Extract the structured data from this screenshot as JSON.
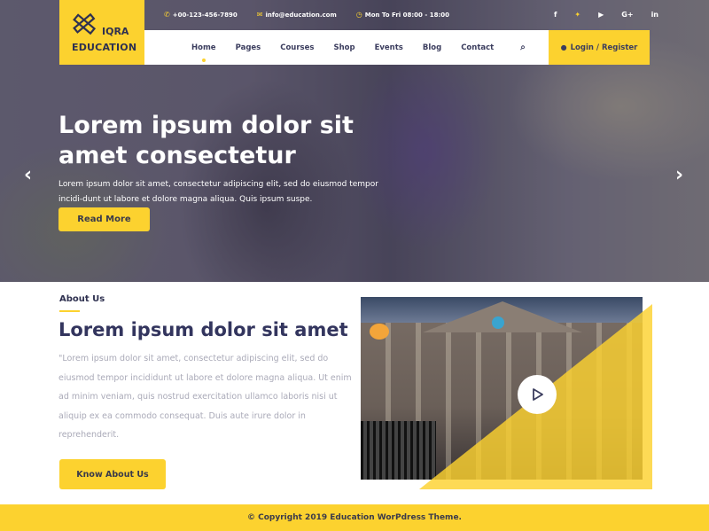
{
  "brand": {
    "line1": "IQRA",
    "line2": "EDUCATION"
  },
  "topbar": {
    "phone": "+00-123-456-7890",
    "email": "info@education.com",
    "hours": "Mon To Fri 08:00 - 18:00",
    "icons": {
      "phone": "✆",
      "email": "✉",
      "hours": "◷"
    }
  },
  "social": [
    {
      "name": "facebook",
      "glyph": "f"
    },
    {
      "name": "twitter",
      "glyph": "🐦"
    },
    {
      "name": "youtube",
      "glyph": "▶"
    },
    {
      "name": "google-plus",
      "glyph": "G+"
    },
    {
      "name": "linkedin",
      "glyph": "in"
    }
  ],
  "nav": {
    "items": [
      "Home",
      "Pages",
      "Courses",
      "Shop",
      "Events",
      "Blog",
      "Contact"
    ],
    "active": "Home",
    "search_icon": "⌕",
    "login_label": "Login / Register",
    "user_icon": "👤"
  },
  "hero": {
    "title_line1": "Lorem ipsum dolor sit",
    "title_line2": "amet consectetur",
    "text": "Lorem ipsum dolor sit amet, consectetur adipiscing elit, sed do eiusmod tempor incidi-dunt ut labore et dolore magna aliqua. Quis ipsum suspe.",
    "button": "Read More",
    "prev": "‹",
    "next": "›"
  },
  "about": {
    "label": "About Us",
    "title": "Lorem ipsum dolor sit amet",
    "text": "\"Lorem ipsum dolor sit amet, consectetur adipiscing elit, sed do eiusmod tempor incididunt ut labore et dolore magna aliqua. Ut enim ad minim veniam, quis nostrud exercitation ullamco laboris nisi ut aliquip ex ea commodo consequat. Duis aute irure dolor in reprehenderit.",
    "button": "Know About Us"
  },
  "footer": {
    "copyright": "© Copyright 2019 Education WorPdress Theme."
  },
  "colors": {
    "accent": "#fcd22f",
    "navy": "#33355e"
  }
}
